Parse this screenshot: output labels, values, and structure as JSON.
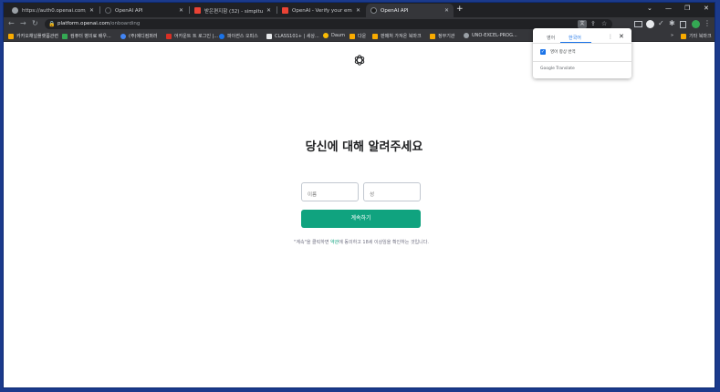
{
  "colors": {
    "accent": "#10a37f",
    "chrome_dark": "#202124",
    "chrome_toolbar": "#35363a",
    "link_blue": "#1a73e8"
  },
  "tabs": [
    {
      "title": "https://auth0.openai.com/u/sig-",
      "favicon": "globe-icon",
      "favicon_color": "#9aa0a6"
    },
    {
      "title": "OpenAI API",
      "favicon": "openai-icon",
      "favicon_color": "#202124"
    },
    {
      "title": "받은편지함 (32) - simpltus72@...",
      "favicon": "gmail-icon",
      "favicon_color": "#ea4335"
    },
    {
      "title": "OpenAI - Verify your email - sk",
      "favicon": "gmail-icon",
      "favicon_color": "#ea4335"
    },
    {
      "title": "OpenAI API",
      "favicon": "openai-icon",
      "favicon_color": "#1a1a1a",
      "active": true
    }
  ],
  "window_controls": {
    "minimize": "—",
    "maximize": "❐",
    "close": "✕"
  },
  "address_bar": {
    "host": "platform.openai.com",
    "path": "/onboarding"
  },
  "bookmarks": [
    {
      "label": "카카오채널플랫폼관련",
      "color": "#f9ab00"
    },
    {
      "label": "컴퓨터 병의료 배우...",
      "color": "#34a853"
    },
    {
      "label": "(주)에디컴퍼러",
      "color": "#4285f4"
    },
    {
      "label": "어카운트 트 로그인 |...",
      "color": "#d93025"
    },
    {
      "label": "파이썬스 오피스",
      "color": "#1a73e8"
    },
    {
      "label": "CLASS101+ | 세상...",
      "color": "#e8eaed"
    },
    {
      "label": "Daum",
      "color": "#fbbc04"
    },
    {
      "label": "다운",
      "color": "#f9ab00"
    },
    {
      "label": "판매처 가져온 북마크",
      "color": "#f9ab00"
    },
    {
      "label": "정부기관",
      "color": "#f9ab00"
    },
    {
      "label": "UNO-EXCEL-PROG...",
      "color": "#9aa0a6"
    },
    {
      "label": "기타 북마크",
      "color": "#f9ab00"
    }
  ],
  "translate_popup": {
    "tab_source": "영어",
    "tab_target": "한국어",
    "checkbox_label": "영어 항상 번역",
    "checkbox_checked": true,
    "footer": "Google Translate",
    "menu_glyph": "⋮",
    "close_glyph": "✕"
  },
  "onboarding": {
    "headline": "당신에 대해 알려주세요",
    "first_name_placeholder": "이름",
    "last_name_placeholder": "성",
    "continue_label": "계속하기",
    "terms_prefix": "\"계속\"을 클릭하면 ",
    "terms_link": "약관",
    "terms_suffix": "에 동의하고 18세 이상임을 확인하는 것입니다."
  }
}
